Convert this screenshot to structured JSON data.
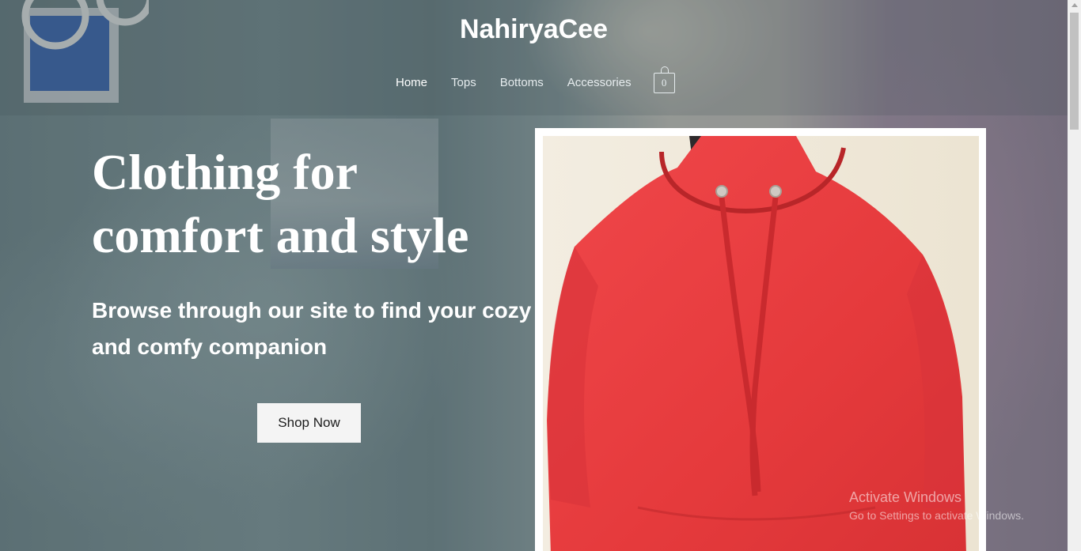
{
  "site": {
    "title": "NahiryaCee"
  },
  "nav": {
    "items": [
      "Home",
      "Tops",
      "Bottoms",
      "Accessories"
    ],
    "active": "Home",
    "cart_count": "0"
  },
  "hero": {
    "title_line1": "Clothing for",
    "title_line2": "comfort and style",
    "subtitle": "Browse through our site to find your cozy and comfy companion",
    "cta_label": "Shop Now"
  },
  "watermark": {
    "line1": "Activate Windows",
    "line2": "Go to Settings to activate Windows."
  },
  "colors": {
    "hoodie": "#ea3b3e",
    "button_bg": "#f4f4f4",
    "text": "#ffffff"
  }
}
